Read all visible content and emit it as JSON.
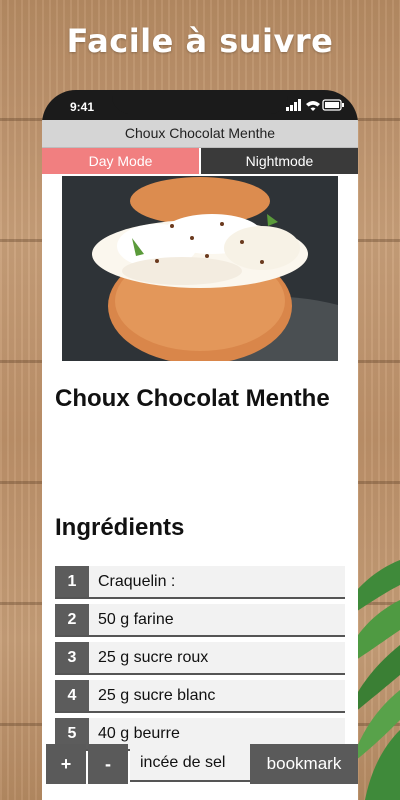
{
  "promo": {
    "headline": "Facile à suivre"
  },
  "status_bar": {
    "time": "9:41"
  },
  "app": {
    "title": "Choux Chocolat Menthe",
    "mode_buttons": {
      "day": "Day Mode",
      "night": "Nightmode"
    }
  },
  "recipe": {
    "title": "Choux Chocolat Menthe",
    "ingredients_heading": "Ingrédients",
    "ingredients": [
      {
        "num": "1",
        "text": "Craquelin :"
      },
      {
        "num": "2",
        "text": "50 g farine"
      },
      {
        "num": "3",
        "text": "25 g sucre roux"
      },
      {
        "num": "4",
        "text": "25 g sucre blanc"
      },
      {
        "num": "5",
        "text": "40 g beurre"
      }
    ],
    "partial_ingredient": "incée de sel"
  },
  "bottom_bar": {
    "plus": "+",
    "minus": "-",
    "bookmark": "bookmark"
  },
  "colors": {
    "day_mode": "#f17f80",
    "night_mode": "#3a3a3a",
    "accent_dark": "#5a5a5a"
  }
}
